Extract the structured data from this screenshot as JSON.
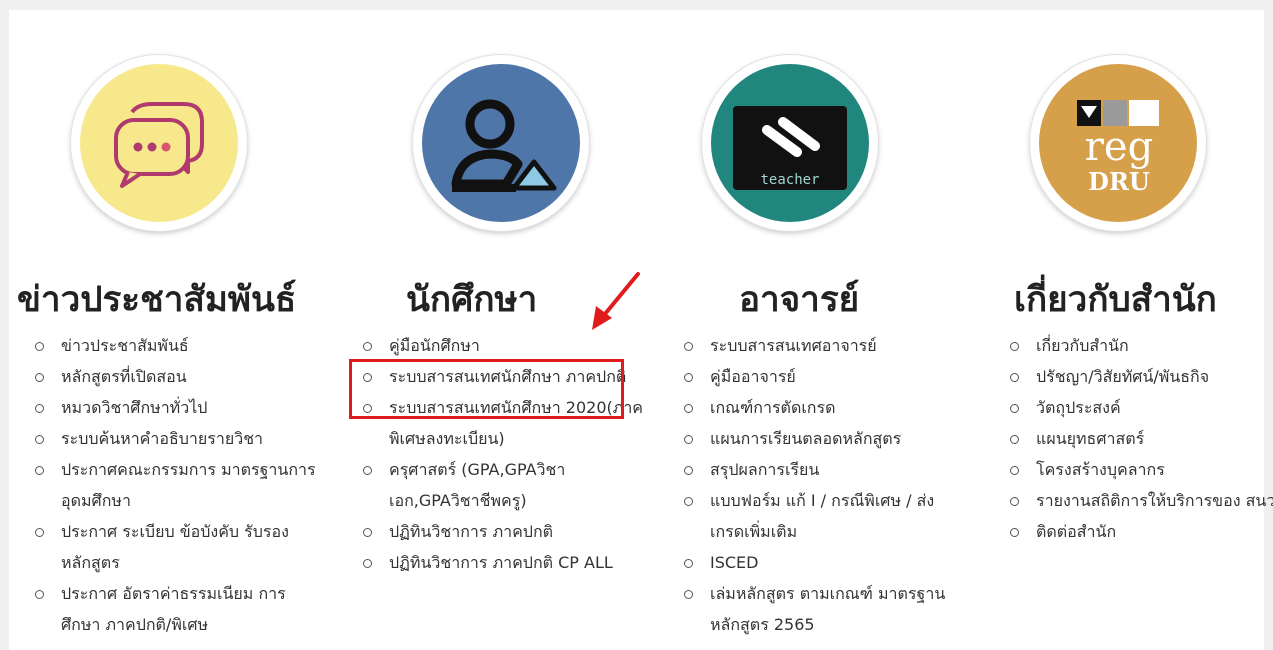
{
  "columns": [
    {
      "title": "ข่าวประชาสัมพันธ์",
      "icon": "speech-bubbles-icon",
      "color": "#f7e88c",
      "links": [
        "ข่าวประชาสัมพันธ์",
        "หลักสูตรที่เปิดสอน",
        "หมวดวิชาศึกษาทั่วไป",
        "ระบบค้นหาคำอธิบายรายวิชา",
        "ประกาศคณะกรรมการ มาตรฐานการอุดมศึกษา",
        "ประกาศ ระเบียบ ข้อบังคับ รับรองหลักสูตร",
        "ประกาศ อัตราค่าธรรมเนียม การศึกษา ภาคปกติ/พิเศษ"
      ]
    },
    {
      "title": "นักศึกษา",
      "icon": "student-icon",
      "color": "#4f76a8",
      "links": [
        "คู่มือนักศึกษา",
        "ระบบสารสนเทศนักศึกษา ภาคปกติ",
        "ระบบสารสนเทศนักศึกษา 2020(ภาคพิเศษลงทะเบียน)",
        "ครุศาสตร์ (GPA,GPAวิชา เอก,GPAวิชาชีพครู)",
        "ปฏิทินวิชาการ ภาคปกติ",
        "ปฏิทินวิชาการ ภาคปกติ CP ALL"
      ]
    },
    {
      "title": "อาจารย์",
      "icon": "teacher-icon",
      "logo_text": "teacher",
      "color": "#21867d",
      "links": [
        "ระบบสารสนเทศอาจารย์",
        "คู่มืออาจารย์",
        "เกณฑ์การตัดเกรด",
        "แผนการเรียนตลอดหลักสูตร",
        "สรุปผลการเรียน",
        "แบบฟอร์ม แก้ I / กรณีพิเศษ / ส่งเกรดเพิ่มเติม",
        "ISCED",
        "เล่มหลักสูตร ตามเกณฑ์ มาตรฐานหลักสูตร 2565"
      ]
    },
    {
      "title": "เกี่ยวกับสำนัก",
      "icon": "reg-dru-logo-icon",
      "logo_text_top": "reg",
      "logo_text_bottom": "DRU",
      "color": "#d6a04a",
      "links": [
        "เกี่ยวกับสำนัก",
        "ปรัชญา/วิสัยทัศน์/พันธกิจ",
        "วัตถุประสงค์",
        "แผนยุทธศาสตร์",
        "โครงสร้างบุคลากร",
        "รายงานสถิติการให้บริการของ สนว.",
        "ติดต่อสำนัก"
      ]
    }
  ],
  "annotation": {
    "highlight_color": "#e11b1b",
    "highlighted_link": "ระบบสารสนเทศนักศึกษา ภาคปกติ"
  }
}
